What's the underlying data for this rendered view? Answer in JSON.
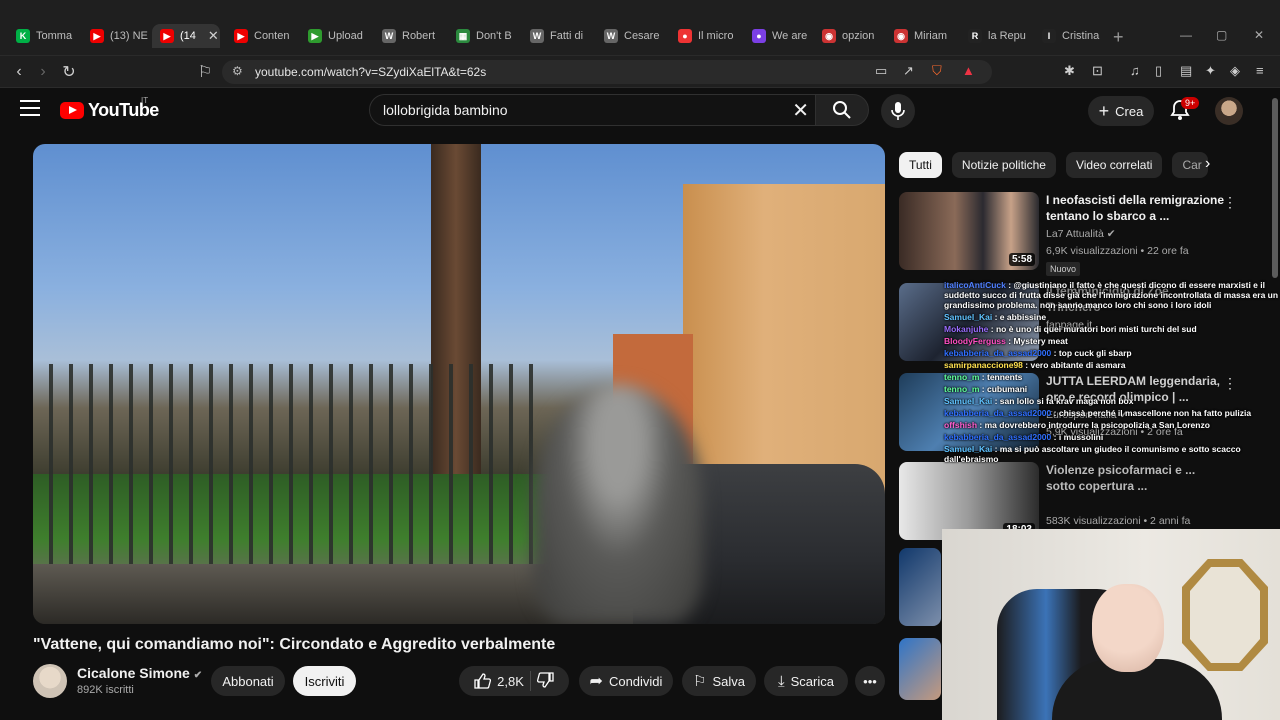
{
  "browser": {
    "tabs": [
      {
        "label": "Tomma",
        "fav": "K",
        "color": "#00b046"
      },
      {
        "label": "(13) NE",
        "fav": "▶",
        "color": "#e00"
      },
      {
        "label": "(14",
        "fav": "▶",
        "color": "#e00",
        "active": true
      },
      {
        "label": "Conten",
        "fav": "▶",
        "color": "#e00"
      },
      {
        "label": "Upload",
        "fav": "▶",
        "color": "#2e9b2e"
      },
      {
        "label": "Robert",
        "fav": "W",
        "color": "#666"
      },
      {
        "label": "Don't B",
        "fav": "▦",
        "color": "#2b8a3e"
      },
      {
        "label": "Fatti di",
        "fav": "W",
        "color": "#666"
      },
      {
        "label": "Cesare",
        "fav": "W",
        "color": "#666"
      },
      {
        "label": "Il micro",
        "fav": "●",
        "color": "#e33"
      },
      {
        "label": "We are",
        "fav": "●",
        "color": "#7b3fe4"
      },
      {
        "label": "opzion",
        "fav": "◉",
        "color": "#c33"
      },
      {
        "label": "Miriam",
        "fav": "◉",
        "color": "#c33"
      },
      {
        "label": "la Repu",
        "fav": "R",
        "color": "#222"
      },
      {
        "label": "Cristina",
        "fav": "I",
        "color": "#222"
      }
    ],
    "url": "youtube.com/watch?v=SZydiXaElTA&t=62s",
    "ext_badge": "1"
  },
  "youtube": {
    "logo_text": "YouTube",
    "country": "IT",
    "search_query": "lollobrigida bambino",
    "create_label": "Crea",
    "notif_count": "9+"
  },
  "video": {
    "title": "\"Vattene, qui comandiamo noi\": Circondato e Aggredito verbalmente",
    "channel": "Cicalone Simone",
    "subscribers": "892K iscritti",
    "subscribed_label": "Abbonati",
    "subscribe_label": "Iscriviti",
    "likes": "2,8K",
    "share_label": "Condividi",
    "save_label": "Salva",
    "download_label": "Scarica"
  },
  "chips": [
    "Tutti",
    "Notizie politiche",
    "Video correlati",
    "Car"
  ],
  "recommendations": [
    {
      "title": "I neofascisti della remigrazione tentano lo sbarco a ...",
      "channel": "La7 Attualità",
      "meta": "6,9K visualizzazioni • 22 ore fa",
      "duration": "5:58",
      "badge": "Nuovo"
    },
    {
      "title": "Il femminicidio di Zoe Trinchero",
      "channel": "fanpage.it",
      "meta": "",
      "duration": "",
      "badge": ""
    },
    {
      "title": "JUTTA LEERDAM leggendaria, oro e record olimpico | ...",
      "channel": "Eurosport Italia",
      "meta": "5,9K visualizzazioni • 2 ore fa",
      "duration": "",
      "badge": ""
    },
    {
      "title": "Violenze psicofarmaci e ... sotto copertura ...",
      "channel": "",
      "meta": "583K visualizzazioni • 2 anni fa",
      "duration": "18:03",
      "badge": ""
    }
  ],
  "chat": [
    {
      "user": "italicoAntiCuck",
      "color": "#4f7fff",
      "text": "@giustiniano il fatto è che questi dicono di essere marxisti e il suddetto succo di frutta disse già che l'immigrazione incontrollata di massa era un grandissimo problema. non sanno manco loro chi sono i loro idoli"
    },
    {
      "user": "Samuel_Kai",
      "color": "#5fc3ff",
      "text": "e abbissine"
    },
    {
      "user": "Mokanjuhe",
      "color": "#9a6cff",
      "text": "no è uno di quei muratori bori misti turchi del sud"
    },
    {
      "user": "BloodyFerguss",
      "color": "#ff4fc3",
      "text": "Mystery meat"
    },
    {
      "user": "kebabberia_da_assad2000",
      "color": "#2f6fff",
      "text": "top cuck gli sbarp"
    },
    {
      "user": "samirpanaccione98",
      "color": "#ffe14f",
      "text": "vero abitante di asmara"
    },
    {
      "user": "tenno_m",
      "color": "#5fff9a",
      "text": "tennents"
    },
    {
      "user": "tenno_m",
      "color": "#5fff9a",
      "text": "cubumani"
    },
    {
      "user": "Samuel_Kai",
      "color": "#5fc3ff",
      "text": "san lollo si fa krav maga non box"
    },
    {
      "user": "kebabberia_da_assad2000",
      "color": "#2f6fff",
      "text": "chissà perché il mascellone non ha fatto pulizia"
    },
    {
      "user": "offshish",
      "color": "#ff5fd0",
      "text": "ma dovrebbero introdurre la psicopolizia a San Lorenzo"
    },
    {
      "user": "kebabberia_da_assad2000",
      "color": "#2f6fff",
      "text": "i mussolini"
    },
    {
      "user": "Samuel_Kai",
      "color": "#5fc3ff",
      "text": "ma si può ascoltare un giudeo il comunismo e sotto scacco dall'ebraismo"
    }
  ]
}
